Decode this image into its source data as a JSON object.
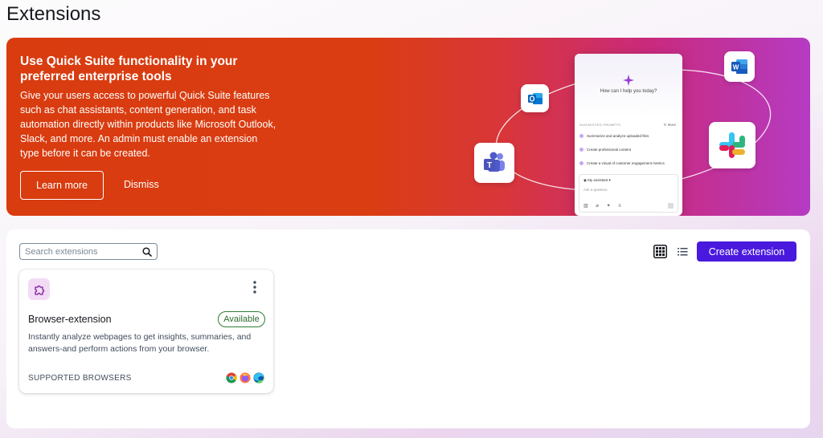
{
  "page": {
    "title": "Extensions"
  },
  "banner": {
    "title": "Use Quick Suite functionality in your preferred enterprise tools",
    "description": "Give your users access to powerful Quick Suite features such as chat assistants, content generation, and task automation directly within products like Microsoft Outlook, Slack, and more. An admin must enable an extension type before it can be created.",
    "learn_more_label": "Learn more",
    "dismiss_label": "Dismiss",
    "illustration": {
      "question": "How can I help you today?",
      "suggested_prompts_label": "SUGGESTED PROMPTS",
      "more_label": "More",
      "prompts": [
        "Summarize and analyze uploaded files",
        "Create professional content",
        "Create a visual of customer engagement metrics"
      ],
      "assistant_label": "My assistant",
      "ask_placeholder": "Ask a question"
    },
    "app_icons": [
      "outlook-icon",
      "teams-icon",
      "word-icon",
      "slack-icon"
    ]
  },
  "toolbar": {
    "search_placeholder": "Search extensions",
    "create_label": "Create extension"
  },
  "cards": [
    {
      "title": "Browser-extension",
      "status": "Available",
      "description": "Instantly analyze webpages to get insights, summaries, and answers-and perform actions from your browser.",
      "footer_label": "SUPPORTED BROWSERS",
      "browsers": [
        "chrome-icon",
        "firefox-icon",
        "edge-icon"
      ]
    }
  ],
  "colors": {
    "accent": "#4a19de",
    "banner_start": "#d83c0f",
    "banner_end": "#b53bc3",
    "available": "#2e7d32"
  }
}
